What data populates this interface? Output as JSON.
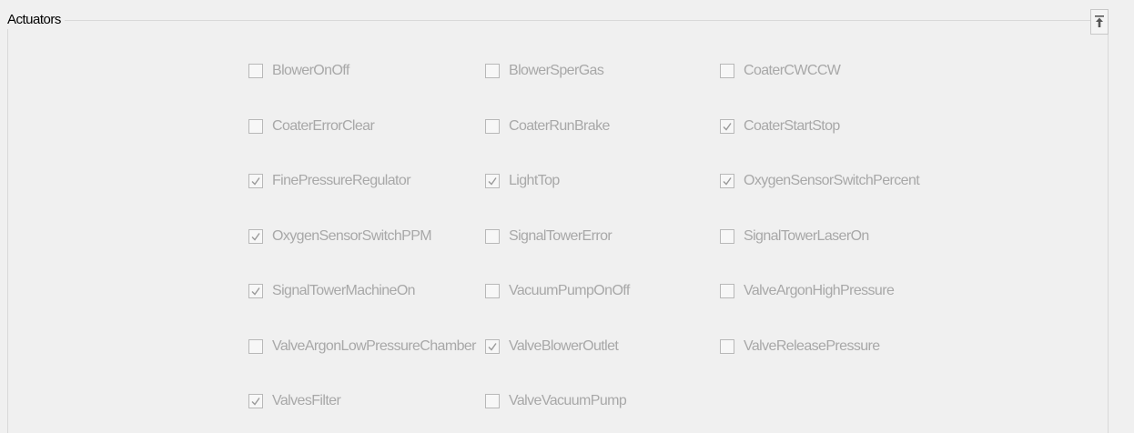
{
  "group": {
    "title": "Actuators"
  },
  "collapse_button": {
    "icon": "collapse-up-icon"
  },
  "actuators": [
    {
      "label": "BlowerOnOff",
      "checked": false
    },
    {
      "label": "BlowerSperGas",
      "checked": false
    },
    {
      "label": "CoaterCWCCW",
      "checked": false
    },
    {
      "label": "CoaterErrorClear",
      "checked": false
    },
    {
      "label": "CoaterRunBrake",
      "checked": false
    },
    {
      "label": "CoaterStartStop",
      "checked": true
    },
    {
      "label": "FinePressureRegulator",
      "checked": true
    },
    {
      "label": "LightTop",
      "checked": true
    },
    {
      "label": "OxygenSensorSwitchPercent",
      "checked": true
    },
    {
      "label": "OxygenSensorSwitchPPM",
      "checked": true
    },
    {
      "label": "SignalTowerError",
      "checked": false
    },
    {
      "label": "SignalTowerLaserOn",
      "checked": false
    },
    {
      "label": "SignalTowerMachineOn",
      "checked": true
    },
    {
      "label": "VacuumPumpOnOff",
      "checked": false
    },
    {
      "label": "ValveArgonHighPressure",
      "checked": false
    },
    {
      "label": "ValveArgonLowPressureChamber",
      "checked": false
    },
    {
      "label": "ValveBlowerOutlet",
      "checked": true
    },
    {
      "label": "ValveReleasePressure",
      "checked": false
    },
    {
      "label": "ValvesFilter",
      "checked": true
    },
    {
      "label": "ValveVacuumPump",
      "checked": false
    }
  ]
}
